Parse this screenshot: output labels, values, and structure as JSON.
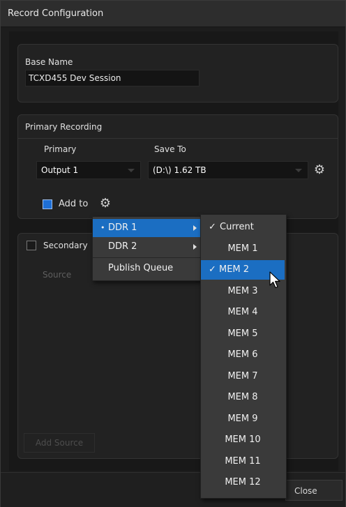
{
  "window": {
    "title": "Record Configuration"
  },
  "base_name": {
    "label": "Base Name",
    "value": "TCXD455 Dev Session"
  },
  "primary_recording": {
    "section_label": "Primary Recording",
    "primary_col_label": "Primary",
    "save_to_col_label": "Save To",
    "primary_value": "Output 1",
    "save_to_value": "(D:\\) 1.62 TB",
    "add_to_label": "Add to",
    "add_to_checked": true
  },
  "secondary": {
    "label": "Secondary",
    "source_label": "Source",
    "add_source_label": "Add Source"
  },
  "footer": {
    "close_label": "Close"
  },
  "context_menu": {
    "items": [
      {
        "label": "DDR 1",
        "bullet": "•",
        "has_submenu": true,
        "selected": true
      },
      {
        "label": "DDR 2",
        "bullet": "",
        "has_submenu": true,
        "selected": false
      },
      {
        "label": "Publish Queue",
        "bullet": "",
        "has_submenu": false,
        "selected": false
      }
    ]
  },
  "submenu": {
    "check_glyph": "✓",
    "items": [
      {
        "label": "Current",
        "checked": true,
        "selected": false
      },
      {
        "label": "MEM 1",
        "checked": false,
        "selected": false
      },
      {
        "label": "MEM 2",
        "checked": true,
        "selected": true
      },
      {
        "label": "MEM 3",
        "checked": false,
        "selected": false
      },
      {
        "label": "MEM 4",
        "checked": false,
        "selected": false
      },
      {
        "label": "MEM 5",
        "checked": false,
        "selected": false
      },
      {
        "label": "MEM 6",
        "checked": false,
        "selected": false
      },
      {
        "label": "MEM 7",
        "checked": false,
        "selected": false
      },
      {
        "label": "MEM 8",
        "checked": false,
        "selected": false
      },
      {
        "label": "MEM 9",
        "checked": false,
        "selected": false
      },
      {
        "label": "MEM 10",
        "checked": false,
        "selected": false
      },
      {
        "label": "MEM 11",
        "checked": false,
        "selected": false
      },
      {
        "label": "MEM 12",
        "checked": false,
        "selected": false
      }
    ]
  },
  "colors": {
    "accent": "#1b6ec2",
    "background": "#1d1d1d",
    "panel": "#222222"
  }
}
